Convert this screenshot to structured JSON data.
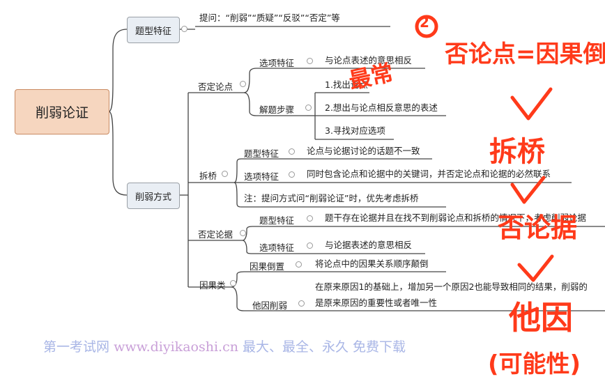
{
  "root": {
    "label": "削弱论证"
  },
  "branch1": {
    "label": "题型特征",
    "question_text": "提问：“削弱”“质疑”“反驳”“否定”等"
  },
  "branch2": {
    "label": "削弱方式",
    "negate_claim": {
      "label": "否定论点",
      "option_label": "选项特征",
      "option_text": "与论点表述的意思相反",
      "steps_label": "解题步骤",
      "step1": "1.找出论点",
      "step2": "2.想出与论点相反意思的表述",
      "step3": "3.寻找对应选项"
    },
    "bridge": {
      "label": "拆桥",
      "type_label": "题型特征",
      "type_text": "论点与论据讨论的话题不一致",
      "option_label": "选项特征",
      "option_text": "同时包含论点和论据中的关键词，并否定论点和论据的必然联系",
      "note": "注：提问方式问“削弱论证”时，优先考虑拆桥"
    },
    "negate_evidence": {
      "label": "否定论据",
      "type_label": "题型特征",
      "type_text": "题干存在论据并且在找不到削弱论点和拆桥的情况下，考虑削弱论据",
      "option_label": "选项特征",
      "option_text": "与论据表述的意思相反"
    },
    "causal": {
      "label": "因果类",
      "reverse_label": "因果倒置",
      "reverse_text": "将论点中的因果关系顺序颠倒",
      "other_label": "他因削弱",
      "other_text_1": "在原来原因1的基础上，增加另一个原因2也能导致相同的结果，削弱的",
      "other_text_2": "是原来原因的重要性或者唯一性"
    }
  },
  "watermark": {
    "site_cn": "第一考试网",
    "url": "www.diyikaoshi.cn",
    "slogan": "最大、最全、永久 免费下载"
  },
  "handwriting": {
    "circle_mark": "2",
    "note_top": "否论点=因果倒",
    "most_common": "最常",
    "bridge": "拆桥",
    "negate": "否论据",
    "other_cause": "他因",
    "possibility": "(可能性)"
  },
  "colors": {
    "root_fill": "#f6d6bf",
    "node_fill": "#e9eef4",
    "annotation": "#ff3a1a",
    "watermark": "#a9b6e6"
  }
}
